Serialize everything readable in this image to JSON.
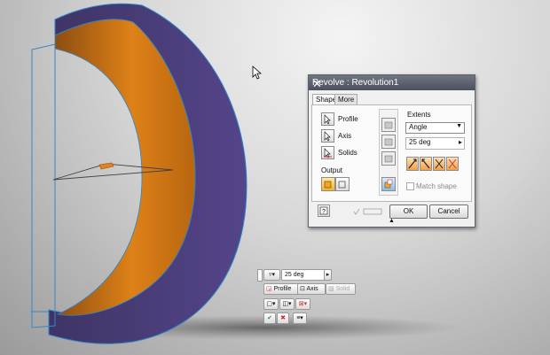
{
  "dialog": {
    "title": "Revolve : Revolution1",
    "close": "✕",
    "tabs": [
      "Shape",
      "More"
    ],
    "profile_label": "Profile",
    "axis_label": "Axis",
    "solids_label": "Solids",
    "output_label": "Output",
    "extents_label": "Extents",
    "extents_value": "Angle",
    "angle_value": "25 deg",
    "match_shape_label": "Match shape",
    "ok_label": "OK",
    "cancel_label": "Cancel",
    "expand_glyph": "▲"
  },
  "minitoolbar": {
    "angle_value": "25 deg",
    "profile_label": "Profile",
    "axis_label": "Axis",
    "solid_label": "Solid"
  },
  "colors": {
    "outer_face": "#4b3e78",
    "inner_face": "#d77c16",
    "edge": "#2b86c7"
  },
  "icons": [
    "select-arrow-icon",
    "ok-check-icon",
    "cancel-x-icon",
    "help-icon"
  ]
}
